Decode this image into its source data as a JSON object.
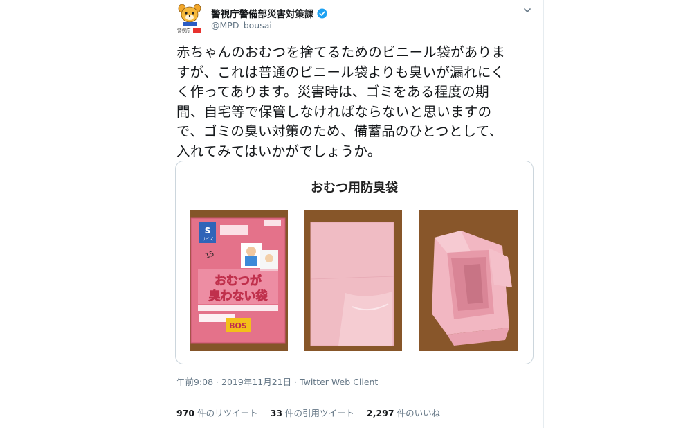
{
  "tweet": {
    "display_name": "警視庁警備部災害対策課",
    "handle": "@MPD_bousai",
    "text_lines": [
      "赤ちゃんのおむつを捨てるためのビニール袋がありま",
      "すが、これは普通のビニール袋よりも臭いが漏れにく",
      "く作ってあります。災害時は、ゴミをある程度の期",
      "間、自宅等で保管しなければならないと思いますの",
      "で、ゴミの臭い対策のため、備蓄品のひとつとして、",
      "入れてみてはいかがでしょうか。"
    ],
    "media_title": "おむつ用防臭袋",
    "timestamp": "午前9:08 · 2019年11月21日",
    "separator": " · ",
    "client": "Twitter Web Client",
    "stats": {
      "retweets_count": "970",
      "retweets_label": "件のリツイート",
      "quotes_count": "33",
      "quotes_label": "件の引用ツイート",
      "likes_count": "2,297",
      "likes_label": "件のいいね"
    }
  },
  "photo1": {
    "brand": "警視庁",
    "size_letter": "S",
    "size_word": "サイズ",
    "count": "15",
    "product_name_1": "おむつが",
    "product_name_2": "臭わない袋",
    "maker": "BOS"
  },
  "colors": {
    "verified": "#1da1f2",
    "text_secondary": "#657786",
    "border": "#ccd6dd",
    "bag_pink": "#f0bcc4",
    "package_pink": "#e4728a",
    "wood": "#8a5a2c"
  },
  "icons": [
    "police-mascot-icon",
    "verified-badge-icon",
    "chevron-down-icon"
  ]
}
